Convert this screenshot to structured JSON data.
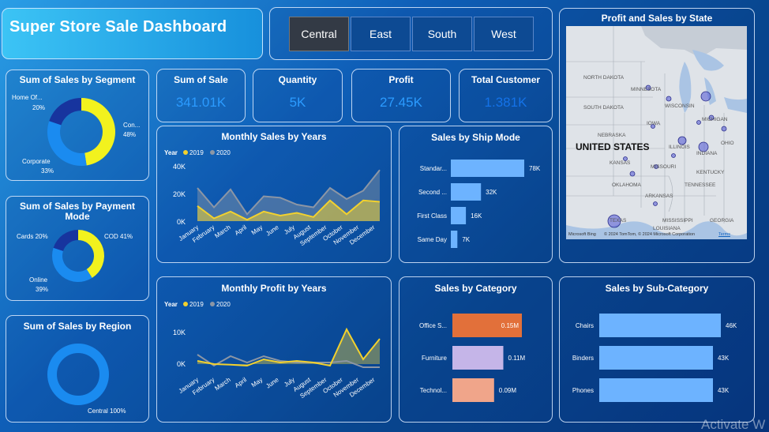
{
  "header": {
    "title": "Super Store Sale Dashboard"
  },
  "region_slicer": {
    "options": [
      "Central",
      "East",
      "South",
      "West"
    ],
    "selected": "Central"
  },
  "kpis": [
    {
      "label": "Sum of Sale",
      "value": "341.01K"
    },
    {
      "label": "Quantity",
      "value": "5K"
    },
    {
      "label": "Profit",
      "value": "27.45K"
    },
    {
      "label": "Total Customer",
      "value": "1.381K"
    }
  ],
  "segment": {
    "title": "Sum of Sales by Segment",
    "labels": [
      {
        "name": "Con...",
        "pct": "48%"
      },
      {
        "name": "Corporate",
        "pct": "33%"
      },
      {
        "name": "Home Of...",
        "pct": "20%"
      }
    ]
  },
  "payment": {
    "title": "Sum of Sales by Payment Mode",
    "labels": [
      {
        "text": "COD 41%"
      },
      {
        "name": "Online",
        "pct": "39%"
      },
      {
        "text": "Cards 20%"
      }
    ]
  },
  "region": {
    "title": "Sum of Sales by Region",
    "labels": [
      {
        "text": "Central 100%"
      }
    ]
  },
  "monthly_sales": {
    "title": "Monthly Sales by Years",
    "legend_title": "Year",
    "series_names": [
      "2019",
      "2020"
    ],
    "yticks": [
      "40K",
      "20K",
      "0K"
    ],
    "months": [
      "January",
      "February",
      "March",
      "April",
      "May",
      "June",
      "July",
      "August",
      "September",
      "October",
      "November",
      "December"
    ]
  },
  "monthly_profit": {
    "title": "Monthly Profit by Years",
    "legend_title": "Year",
    "series_names": [
      "2019",
      "2020"
    ],
    "yticks": [
      "10K",
      "0K"
    ],
    "months": [
      "January",
      "February",
      "March",
      "April",
      "May",
      "June",
      "July",
      "August",
      "September",
      "October",
      "November",
      "December"
    ]
  },
  "ship_mode": {
    "title": "Sales by Ship Mode",
    "categories": [
      "Standar...",
      "Second ...",
      "First Class",
      "Same Day"
    ],
    "value_labels": [
      "78K",
      "32K",
      "16K",
      "7K"
    ]
  },
  "category": {
    "title": "Sales by Category",
    "categories": [
      "Office S...",
      "Furniture",
      "Technol..."
    ],
    "value_labels": [
      "0.15M",
      "0.11M",
      "0.09M"
    ]
  },
  "sub_category": {
    "title": "Sales by Sub-Category",
    "categories": [
      "Chairs",
      "Binders",
      "Phones"
    ],
    "value_labels": [
      "46K",
      "43K",
      "43K"
    ]
  },
  "map": {
    "title": "Profit and Sales by State",
    "country_label": "UNITED STATES",
    "state_labels": [
      "NORTH DAKOTA",
      "MINNESOTA",
      "SOUTH DAKOTA",
      "WISCONSIN",
      "MICHIGAN",
      "IOWA",
      "NEBRASKA",
      "ILLINOIS",
      "INDIANA",
      "OHIO",
      "KANSAS",
      "MISSOURI",
      "KENTUCKY",
      "OKLAHOMA",
      "ARKANSAS",
      "TENNESSEE",
      "TEXAS",
      "MISSISSIPPI",
      "GEORGIA",
      "LOUISIANA"
    ],
    "attribution": "© 2024 TomTom, © 2024 Microsoft Corporation",
    "terms": "Terms",
    "brand": "Microsoft Bing"
  },
  "watermark": "Activate W",
  "chart_data": [
    {
      "type": "area",
      "title": "Monthly Sales by Years",
      "x": [
        "January",
        "February",
        "March",
        "April",
        "May",
        "June",
        "July",
        "August",
        "September",
        "October",
        "November",
        "December"
      ],
      "ylim": [
        0,
        40000
      ],
      "series": [
        {
          "name": "2019",
          "values": [
            11000,
            2000,
            7000,
            1000,
            7000,
            4000,
            6000,
            3000,
            15000,
            5000,
            15000,
            14000
          ]
        },
        {
          "name": "2020",
          "values": [
            24000,
            10000,
            23000,
            5000,
            18000,
            17000,
            12000,
            10000,
            24000,
            16000,
            22000,
            37000
          ]
        }
      ],
      "colors": {
        "2019": "#f2d12e",
        "2020": "#8c96a5"
      }
    },
    {
      "type": "line",
      "title": "Monthly Profit by Years",
      "x": [
        "January",
        "February",
        "March",
        "April",
        "May",
        "June",
        "July",
        "August",
        "September",
        "October",
        "November",
        "December"
      ],
      "ylim": [
        -2000,
        14000
      ],
      "series": [
        {
          "name": "2019",
          "values": [
            1000,
            0,
            -200,
            -500,
            1500,
            500,
            1000,
            500,
            -500,
            11000,
            1500,
            8000
          ]
        },
        {
          "name": "2020",
          "values": [
            3000,
            -500,
            2500,
            500,
            2500,
            1000,
            500,
            500,
            500,
            1000,
            -1000,
            -1000
          ]
        }
      ],
      "colors": {
        "2019": "#f2d12e",
        "2020": "#8c96a5"
      }
    },
    {
      "type": "bar",
      "title": "Sales by Ship Mode",
      "categories": [
        "Standar...",
        "Second ...",
        "First Class",
        "Same Day"
      ],
      "values": [
        78000,
        32000,
        16000,
        7000
      ],
      "color": "#6db3ff"
    },
    {
      "type": "bar",
      "title": "Sales by Category",
      "categories": [
        "Office S...",
        "Furniture",
        "Technol..."
      ],
      "values": [
        150000,
        110000,
        90000
      ],
      "colors": [
        "#e2703a",
        "#c5b5e8",
        "#f0a58a"
      ]
    },
    {
      "type": "bar",
      "title": "Sales by Sub-Category",
      "categories": [
        "Chairs",
        "Binders",
        "Phones"
      ],
      "values": [
        46000,
        43000,
        43000
      ],
      "color": "#6db3ff"
    },
    {
      "type": "pie",
      "title": "Sum of Sales by Segment",
      "categories": [
        "Con...",
        "Corporate",
        "Home Of..."
      ],
      "values": [
        48,
        33,
        20
      ],
      "colors": [
        "#f2f21e",
        "#1a8bf0",
        "#17349e"
      ]
    },
    {
      "type": "pie",
      "title": "Sum of Sales by Payment Mode",
      "categories": [
        "COD",
        "Online",
        "Cards"
      ],
      "values": [
        41,
        39,
        20
      ],
      "colors": [
        "#f2f21e",
        "#1a8bf0",
        "#17349e"
      ]
    },
    {
      "type": "pie",
      "title": "Sum of Sales by Region",
      "categories": [
        "Central"
      ],
      "values": [
        100
      ],
      "colors": [
        "#1a8bf0"
      ]
    }
  ]
}
